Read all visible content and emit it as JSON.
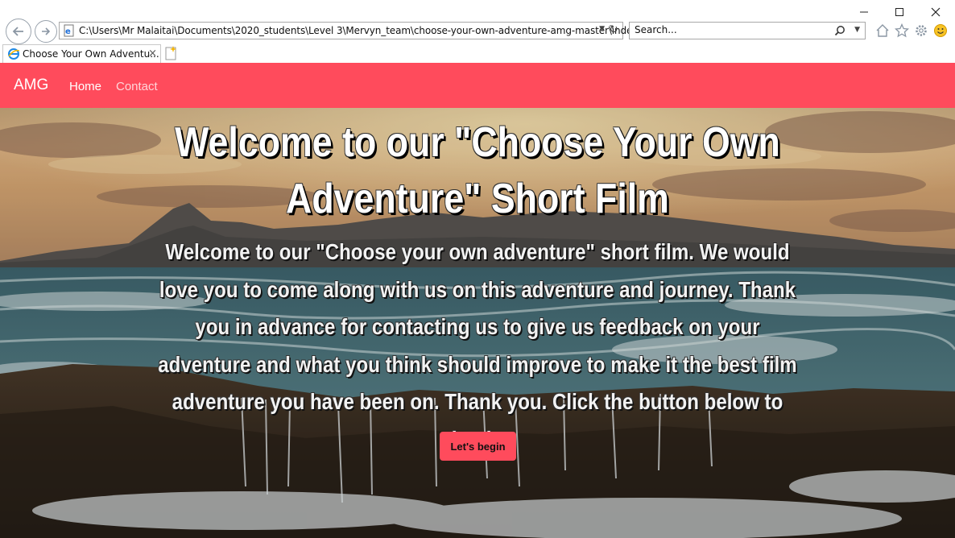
{
  "browser": {
    "address": "C:\\Users\\Mr Malaitai\\Documents\\2020_students\\Level 3\\Mervyn_team\\choose-your-own-adventure-amg-master\\index.",
    "search_placeholder": "Search...",
    "tab_title": "Choose Your Own Adventu...",
    "tab_close": "×",
    "icons": [
      "back-icon",
      "forward-icon",
      "ie-page-icon",
      "dropdown-icon",
      "refresh-icon",
      "search-icon",
      "home-icon",
      "favorites-star-icon",
      "settings-gear-icon",
      "smiley-feedback-icon",
      "new-tab-icon",
      "minimize-icon",
      "maximize-icon",
      "close-icon"
    ]
  },
  "site": {
    "brand": "AMG",
    "nav": {
      "home": "Home",
      "contact": "Contact"
    },
    "colors": {
      "accent": "#ff4b5c",
      "text": "#ffffff"
    }
  },
  "hero": {
    "headline": "Welcome to our \"Choose Your Own Adventure\" Short Film",
    "intro": "Welcome to our \"Choose your own adventure\" short film. We would love you to come along with us on this adventure and journey. Thank you in advance for contacting us to give us feedback on your adventure and what you think should improve to make it the best film adventure you have been on. Thank you. Click the button below to begin",
    "button_label": "Let's begin"
  }
}
